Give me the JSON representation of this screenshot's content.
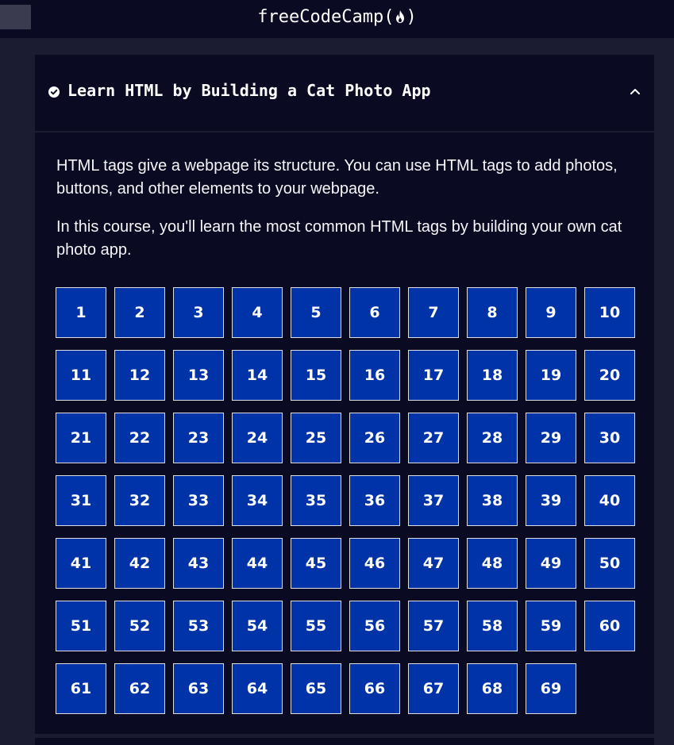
{
  "header": {
    "brand": "freeCodeCamp(",
    "brand_close": ")",
    "flame_icon": "fire-icon"
  },
  "block": {
    "title": "Learn HTML by Building a Cat Photo App",
    "completed_icon": "check-circle-icon",
    "toggle_icon": "chevron-up-icon",
    "intro": [
      "HTML tags give a webpage its structure. You can use HTML tags to add photos, buttons, and other elements to your webpage.",
      "In this course, you'll learn the most common HTML tags by building your own cat photo app."
    ],
    "steps": [
      "1",
      "2",
      "3",
      "4",
      "5",
      "6",
      "7",
      "8",
      "9",
      "10",
      "11",
      "12",
      "13",
      "14",
      "15",
      "16",
      "17",
      "18",
      "19",
      "20",
      "21",
      "22",
      "23",
      "24",
      "25",
      "26",
      "27",
      "28",
      "29",
      "30",
      "31",
      "32",
      "33",
      "34",
      "35",
      "36",
      "37",
      "38",
      "39",
      "40",
      "41",
      "42",
      "43",
      "44",
      "45",
      "46",
      "47",
      "48",
      "49",
      "50",
      "51",
      "52",
      "53",
      "54",
      "55",
      "56",
      "57",
      "58",
      "59",
      "60",
      "61",
      "62",
      "63",
      "64",
      "65",
      "66",
      "67",
      "68",
      "69"
    ]
  },
  "colors": {
    "page_bg": "#1b1b32",
    "panel_bg": "#0a0a23",
    "step_bg": "#0033a8",
    "text": "#ffffff"
  }
}
